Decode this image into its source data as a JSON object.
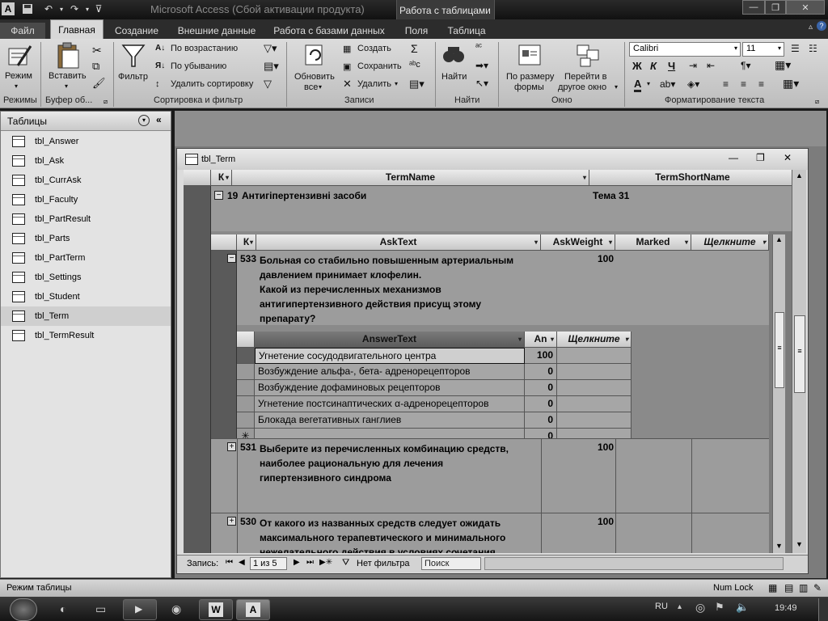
{
  "titlebar": {
    "app_title": "Microsoft Access (Сбой активации продукта)",
    "context_title": "Работа с таблицами"
  },
  "ribbon_tabs": [
    "Файл",
    "Главная",
    "Создание",
    "Внешние данные",
    "Работа с базами данных",
    "Поля",
    "Таблица"
  ],
  "ribbon": {
    "groups": {
      "views": "Режимы",
      "clipboard": "Буфер об...",
      "sort_filter": "Сортировка и фильтр",
      "records": "Записи",
      "find": "Найти",
      "window": "Окно",
      "text_format": "Форматирование текста"
    },
    "view_label": "Режим",
    "paste_label": "Вставить",
    "filter_label": "Фильтр",
    "sort_asc": "По возрастанию",
    "sort_desc": "По убыванию",
    "remove_sort": "Удалить сортировку",
    "refresh_label1": "Обновить",
    "refresh_label2": "все",
    "new_label": "Создать",
    "save_label": "Сохранить",
    "delete_label": "Удалить",
    "find_label": "Найти",
    "fit_label1": "По размеру",
    "fit_label2": "формы",
    "switch_label1": "Перейти в",
    "switch_label2": "другое окно",
    "font_name": "Calibri",
    "font_size": "11",
    "sigma": "Σ",
    "bold": "Ж",
    "italic": "К",
    "underline": "Ч",
    "font_color_letter": "A"
  },
  "nav": {
    "header": "Таблицы",
    "items": [
      "tbl_Answer",
      "tbl_Ask",
      "tbl_CurrAsk",
      "tbl_Faculty",
      "tbl_PartResult",
      "tbl_Parts",
      "tbl_PartTerm",
      "tbl_Settings",
      "tbl_Student",
      "tbl_Term",
      "tbl_TermResult"
    ],
    "selected": "tbl_Term"
  },
  "doc": {
    "title": "tbl_Term",
    "term_headers": {
      "key": "К",
      "name": "TermName",
      "short": "TermShortName"
    },
    "term_row": {
      "id": "19",
      "name": "Антигіпертензивні засоби",
      "short": "Тема 31"
    },
    "ask_headers": {
      "key": "К",
      "text": "AskText",
      "weight": "AskWeight",
      "marked": "Marked",
      "click": "Щелкните"
    },
    "asks": [
      {
        "id": "533",
        "lines": [
          "Больная со стабильно повышенным артериальным",
          "давлением принимает клофелин.",
          "Какой из перечисленных механизмов",
          "антигипертензивного действия присущ этому",
          "препарату?"
        ],
        "weight": "100"
      },
      {
        "id": "531",
        "lines": [
          "Выберите из перечисленных комбинацию средств,",
          "наиболее рациональную для лечения",
          "гипертензивного синдрома"
        ],
        "weight": "100"
      },
      {
        "id": "530",
        "lines": [
          "От какого из названных средств следует ожидать",
          "максимального терапевтического и минимального",
          "нежелательного действия в условиях сочетания"
        ],
        "weight": "100"
      }
    ],
    "answer_headers": {
      "text": "AnswerText",
      "an": "An",
      "click": "Щелкните"
    },
    "answers": [
      {
        "text": "Угнетение сосудодвигательного центра",
        "value": "100"
      },
      {
        "text": "Возбуждение альфа-, бета- адренорецепторов",
        "value": "0"
      },
      {
        "text": "Возбуждение дофаминовых рецепторов",
        "value": "0"
      },
      {
        "text": "Угнетение постсинаптических α-адренорецепторов",
        "value": "0"
      },
      {
        "text": "Блокада вегетативных ганглиев",
        "value": "0"
      }
    ],
    "new_row_value": "0",
    "new_row_marker": "✳",
    "record_nav": {
      "label": "Запись:",
      "current": "1 из 5",
      "filter": "Нет фильтра",
      "search": "Поиск"
    }
  },
  "status": {
    "left": "Режим таблицы",
    "numlock": "Num Lock"
  },
  "taskbar": {
    "lang": "RU",
    "time": "19:49"
  },
  "colors": {
    "ribbon": "#d0d0d0",
    "workspace": "#7c7c7c",
    "taskbar": "#222222"
  }
}
